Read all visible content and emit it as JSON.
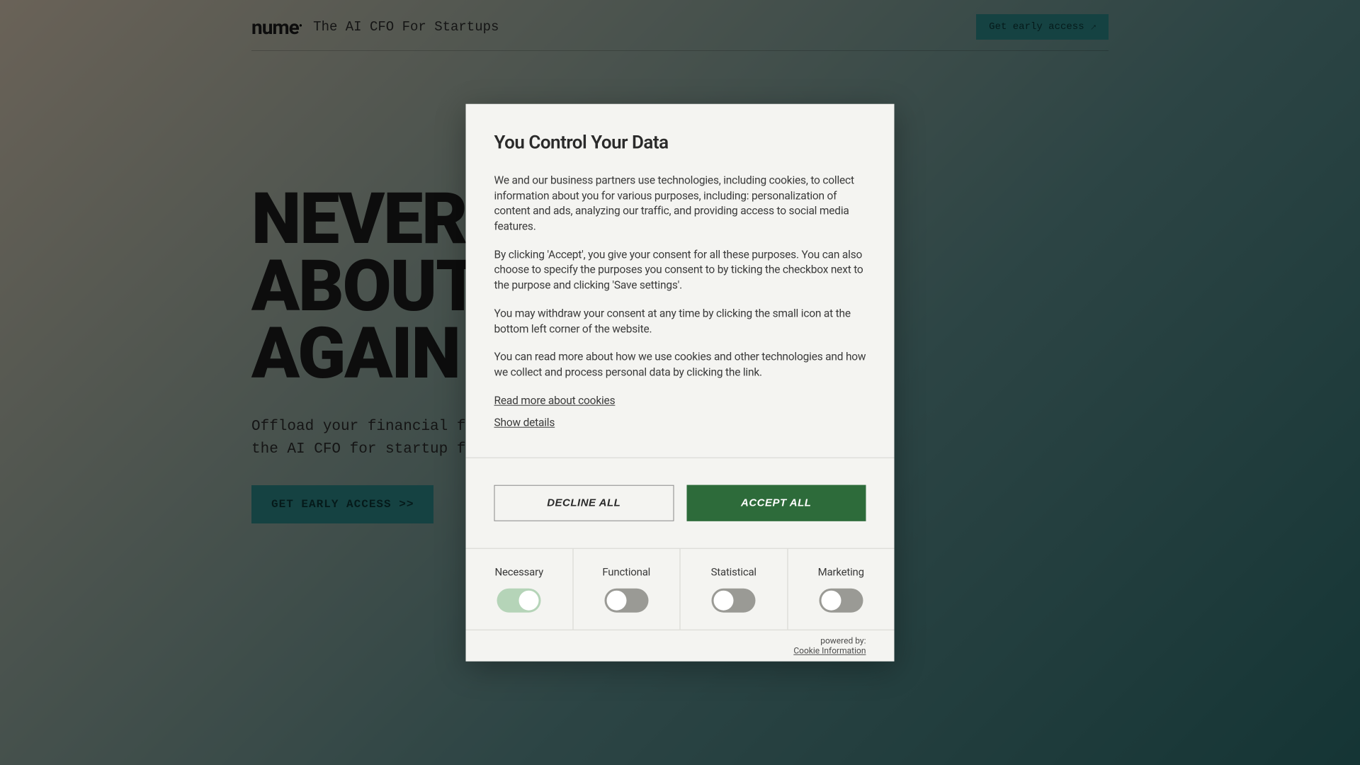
{
  "header": {
    "logo": "nume",
    "logo_dot": "•",
    "tagline": "The AI CFO For Startups",
    "cta_label": "Get early access"
  },
  "hero": {
    "title_line1": "NEVER",
    "title_line2": "ABOUT",
    "title_line3": "AGAIN",
    "subtitle_line1": "Offload your financial fea",
    "subtitle_line2": "the AI CFO for startup fou",
    "cta_label": "GET EARLY ACCESS   >>"
  },
  "modal": {
    "title": "You Control Your Data",
    "paragraphs": [
      "We and our business partners use technologies, including cookies, to collect information about you for various purposes, including: personalization of content and ads, analyzing our traffic, and providing access to social media features.",
      "By clicking 'Accept', you give your consent for all these purposes. You can also choose to specify the purposes you consent to by ticking the checkbox next to the purpose and clicking 'Save settings'.",
      "You may withdraw your consent at any time by clicking the small icon at the bottom left corner of the website.",
      "You can read more about how we use cookies and other technologies and how we collect and process personal data by clicking the link."
    ],
    "link_cookies": "Read more about cookies",
    "link_details": "Show details",
    "decline_label": "DECLINE ALL",
    "accept_label": "ACCEPT ALL",
    "categories": [
      {
        "label": "Necessary",
        "state": "on-disabled"
      },
      {
        "label": "Functional",
        "state": "off"
      },
      {
        "label": "Statistical",
        "state": "off"
      },
      {
        "label": "Marketing",
        "state": "off"
      }
    ],
    "powered_by": "powered by:",
    "powered_link": "Cookie Information"
  }
}
